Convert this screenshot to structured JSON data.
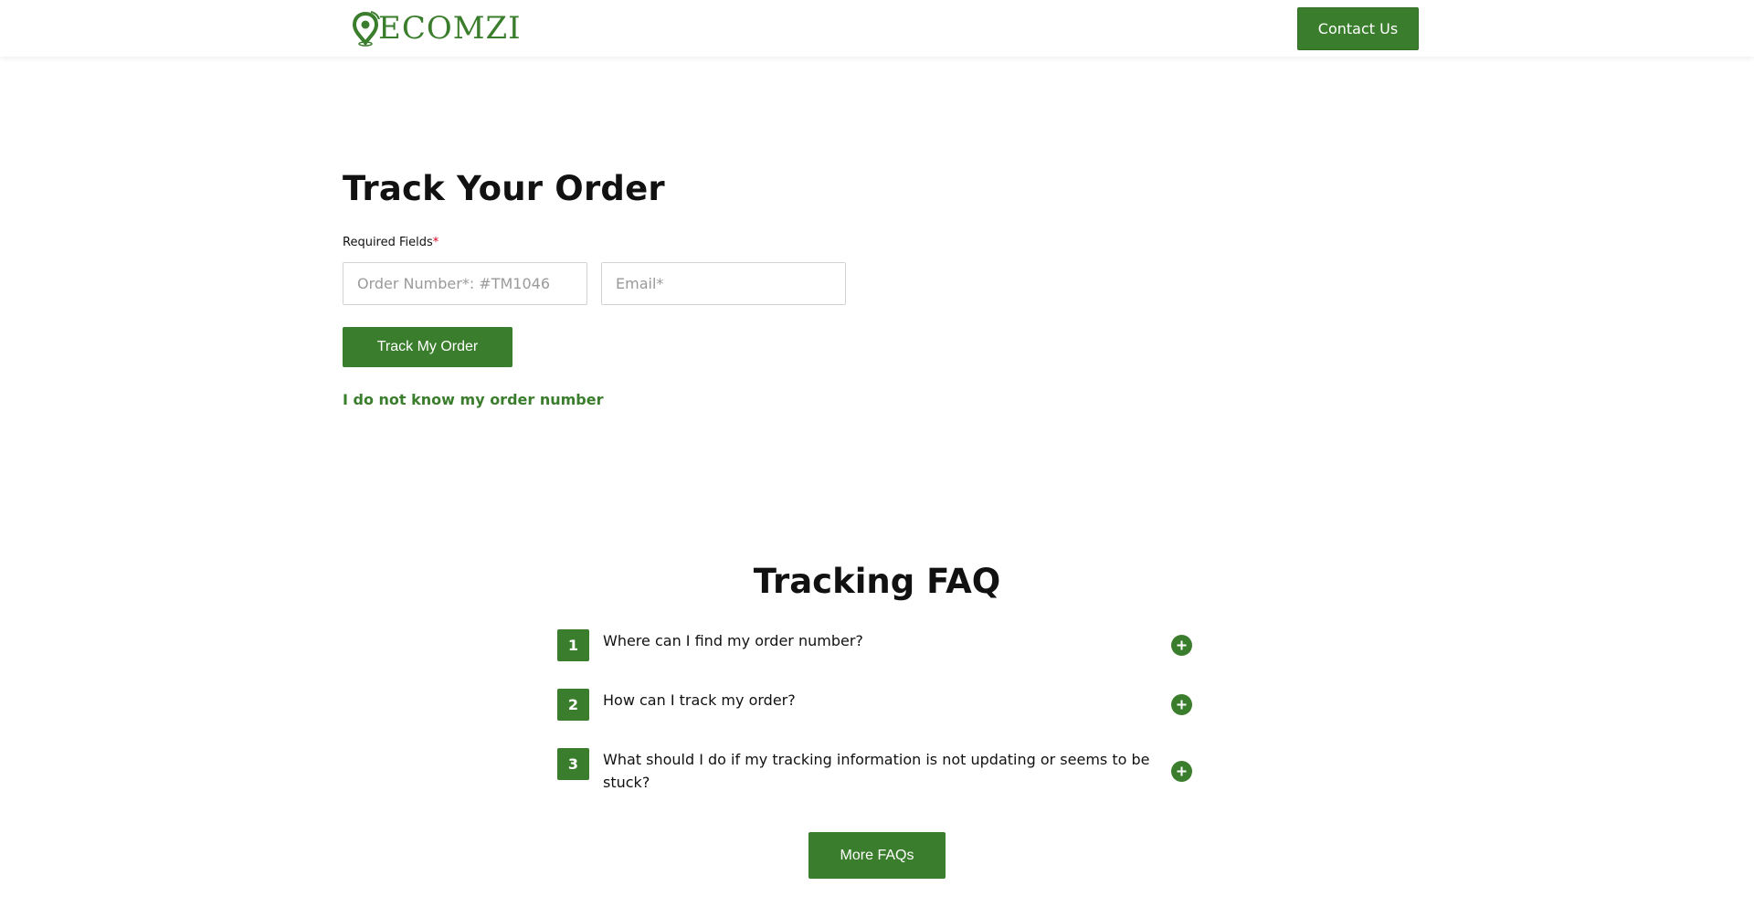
{
  "header": {
    "logo_text": "ECOMZI",
    "logo_icon": "location-pin-icon",
    "contact_label": "Contact Us"
  },
  "track": {
    "title": "Track Your Order",
    "required_label": "Required Fields",
    "required_star": "*",
    "order_placeholder": "Order Number*: #TM1046",
    "order_value": "",
    "email_placeholder": "Email*",
    "email_value": "",
    "submit_label": "Track My Order",
    "unknown_link": "I do not know my order number"
  },
  "faq": {
    "title": "Tracking FAQ",
    "toggle_icon": "plus-circle-icon",
    "items": [
      {
        "number": "1",
        "question": "Where can I find my order number?"
      },
      {
        "number": "2",
        "question": "How can I track my order?"
      },
      {
        "number": "3",
        "question": "What should I do if my tracking information is not updating or seems to be stuck?"
      }
    ],
    "more_label": "More FAQs"
  },
  "colors": {
    "brand_green": "#3a7d2c",
    "required_red": "#d0021b",
    "text": "#111111",
    "border": "#d3d3d3"
  }
}
